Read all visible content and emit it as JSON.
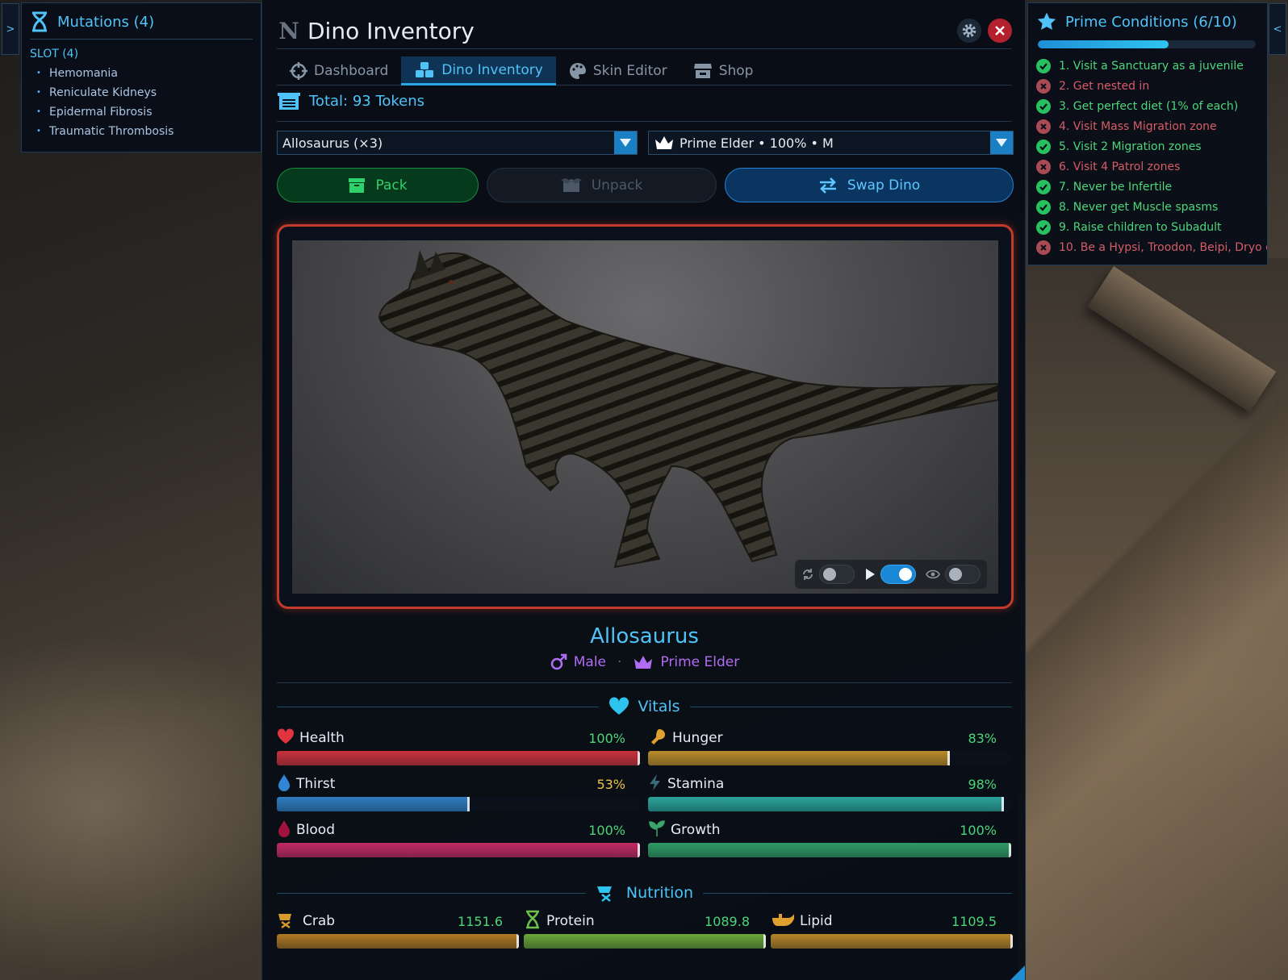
{
  "mutations": {
    "title": "Mutations (4)",
    "slot_label": "SLOT (4)",
    "items": [
      "Hemomania",
      "Reniculate Kidneys",
      "Epidermal Fibrosis",
      "Traumatic Thrombosis"
    ]
  },
  "prime": {
    "title": "Prime Conditions (6/10)",
    "progress": 0.6,
    "conditions": [
      {
        "text": "1. Visit a Sanctuary as a juvenile",
        "done": true
      },
      {
        "text": "2. Get nested in",
        "done": false
      },
      {
        "text": "3. Get perfect diet (1% of each)",
        "done": true
      },
      {
        "text": "4. Visit Mass Migration zone",
        "done": false
      },
      {
        "text": "5. Visit 2 Migration zones",
        "done": true
      },
      {
        "text": "6. Visit 4 Patrol zones",
        "done": false
      },
      {
        "text": "7. Never be Infertile",
        "done": true
      },
      {
        "text": "8. Never get Muscle spasms",
        "done": true
      },
      {
        "text": "9. Raise children to Subadult",
        "done": true
      },
      {
        "text": "10. Be a Hypsi, Troodon, Beipi, Dryo o",
        "done": false
      }
    ]
  },
  "edge": {
    "left": ">",
    "right": "<"
  },
  "main": {
    "logo": "N",
    "title": "Dino Inventory",
    "tabs": [
      {
        "label": "Dashboard",
        "icon": "crosshair-icon"
      },
      {
        "label": "Dino Inventory",
        "icon": "cubes-icon"
      },
      {
        "label": "Skin Editor",
        "icon": "palette-icon"
      },
      {
        "label": "Shop",
        "icon": "store-icon"
      }
    ],
    "tokens": "Total: 93 Tokens",
    "species_select": "Allosaurus (×3)",
    "variant_select": "Prime Elder • 100% • M",
    "buttons": {
      "pack": "Pack",
      "unpack": "Unpack",
      "swap": "Swap Dino"
    },
    "viewer_toggles": {
      "rotate": false,
      "play": true,
      "view": false
    }
  },
  "dino": {
    "name": "Allosaurus",
    "sex": "Male",
    "tier": "Prime Elder"
  },
  "vitals": {
    "title": "Vitals",
    "stats": [
      {
        "name": "Health",
        "value": "100%",
        "pct": 100,
        "color": "#c8323c",
        "val_color": "#4cd67a"
      },
      {
        "name": "Hunger",
        "value": "83%",
        "pct": 83,
        "color": "#b88a2a",
        "val_color": "#4cd67a"
      },
      {
        "name": "Thirst",
        "value": "53%",
        "pct": 53,
        "color": "#2f7dc0",
        "val_color": "#e8c547"
      },
      {
        "name": "Stamina",
        "value": "98%",
        "pct": 98,
        "color": "#2aa39a",
        "val_color": "#4cd67a"
      },
      {
        "name": "Blood",
        "value": "100%",
        "pct": 100,
        "color": "#c12a62",
        "val_color": "#4cd67a"
      },
      {
        "name": "Growth",
        "value": "100%",
        "pct": 100,
        "color": "#2f9a64",
        "val_color": "#4cd67a"
      }
    ]
  },
  "nutrition": {
    "title": "Nutrition",
    "items": [
      {
        "name": "Crab",
        "value": "1151.6",
        "color": "#b07a24"
      },
      {
        "name": "Protein",
        "value": "1089.8",
        "color": "#6aa83a"
      },
      {
        "name": "Lipid",
        "value": "1109.5",
        "color": "#b8862a"
      }
    ]
  }
}
